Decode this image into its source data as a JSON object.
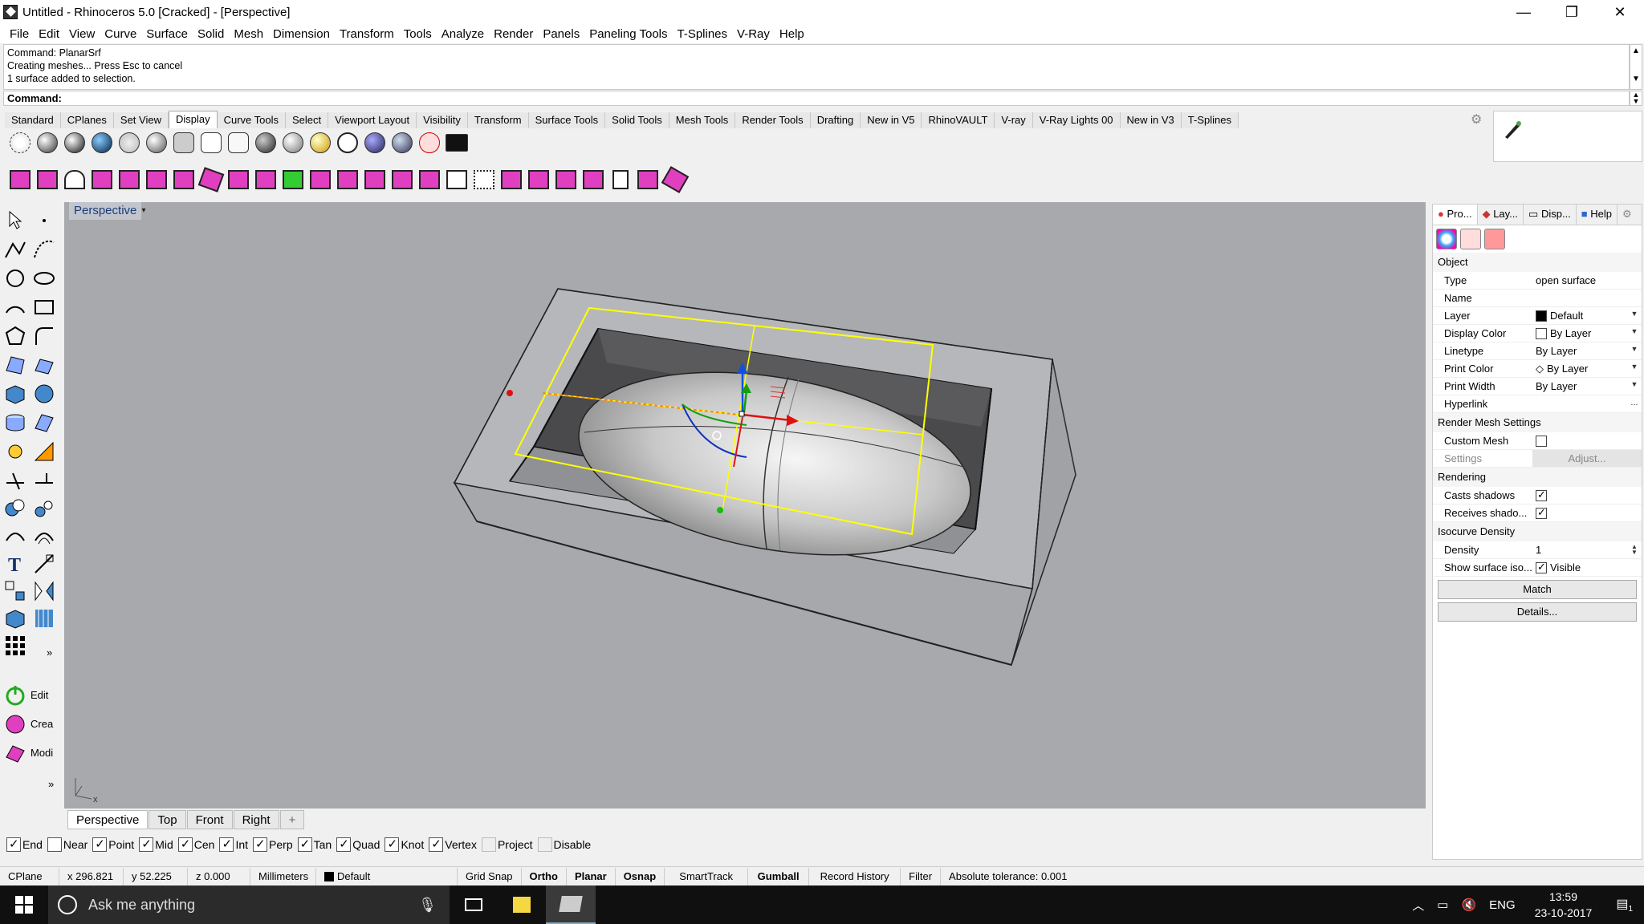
{
  "window": {
    "title": "Untitled - Rhinoceros 5.0 [Cracked] - [Perspective]",
    "minimize": "—",
    "maximize": "❐",
    "close": "✕"
  },
  "menu": [
    "File",
    "Edit",
    "View",
    "Curve",
    "Surface",
    "Solid",
    "Mesh",
    "Dimension",
    "Transform",
    "Tools",
    "Analyze",
    "Render",
    "Panels",
    "Paneling Tools",
    "T-Splines",
    "V-Ray",
    "Help"
  ],
  "command_history": [
    "Command: PlanarSrf",
    "Creating meshes... Press Esc to cancel",
    "1 surface added to selection."
  ],
  "command_prompt": {
    "label": "Command:",
    "value": ""
  },
  "toolbar_tabs": [
    "Standard",
    "CPlanes",
    "Set View",
    "Display",
    "Curve Tools",
    "Select",
    "Viewport Layout",
    "Visibility",
    "Transform",
    "Surface Tools",
    "Solid Tools",
    "Mesh Tools",
    "Render Tools",
    "Drafting",
    "New in V5",
    "RhinoVAULT",
    "V-ray",
    "V-Ray Lights 00",
    "New in V3",
    "T-Splines"
  ],
  "toolbar_active_tab": "Display",
  "left_tools": {
    "edit": "Edit",
    "create": "Crea",
    "modify": "Modi",
    "more": "»"
  },
  "viewport": {
    "title": "Perspective",
    "caret": "▾",
    "axis_x": "x"
  },
  "viewport_tabs": [
    "Perspective",
    "Top",
    "Front",
    "Right"
  ],
  "viewport_tab_add": "+",
  "osnaps": [
    {
      "label": "End",
      "on": true
    },
    {
      "label": "Near",
      "on": false
    },
    {
      "label": "Point",
      "on": true
    },
    {
      "label": "Mid",
      "on": true
    },
    {
      "label": "Cen",
      "on": true
    },
    {
      "label": "Int",
      "on": true
    },
    {
      "label": "Perp",
      "on": true
    },
    {
      "label": "Tan",
      "on": true
    },
    {
      "label": "Quad",
      "on": true
    },
    {
      "label": "Knot",
      "on": true
    },
    {
      "label": "Vertex",
      "on": true
    },
    {
      "label": "Project",
      "on": false,
      "disabled": true
    },
    {
      "label": "Disable",
      "on": false,
      "disabled": true
    }
  ],
  "status": {
    "cplane": "CPlane",
    "x": "x 296.821",
    "y": "y 52.225",
    "z": "z 0.000",
    "units": "Millimeters",
    "layer": "Default",
    "grid_snap": "Grid Snap",
    "ortho": "Ortho",
    "planar": "Planar",
    "osnap": "Osnap",
    "smarttrack": "SmartTrack",
    "gumball": "Gumball",
    "record_history": "Record History",
    "filter": "Filter",
    "tolerance": "Absolute tolerance: 0.001"
  },
  "props": {
    "tabs": [
      "Pro...",
      "Lay...",
      "Disp...",
      "Help"
    ],
    "section_object": "Object",
    "type_k": "Type",
    "type_v": "open surface",
    "name_k": "Name",
    "name_v": "",
    "layer_k": "Layer",
    "layer_v": "Default",
    "dispcolor_k": "Display Color",
    "dispcolor_v": "By Layer",
    "linetype_k": "Linetype",
    "linetype_v": "By Layer",
    "printcolor_k": "Print Color",
    "printcolor_v": "By Layer",
    "printwidth_k": "Print Width",
    "printwidth_v": "By Layer",
    "hyperlink_k": "Hyperlink",
    "hyperlink_btn": "...",
    "section_rms": "Render Mesh Settings",
    "custommesh_k": "Custom Mesh",
    "settings_k": "Settings",
    "adjust_btn": "Adjust...",
    "section_rendering": "Rendering",
    "casts_k": "Casts shadows",
    "receives_k": "Receives shado...",
    "section_iso": "Isocurve Density",
    "density_k": "Density",
    "density_v": "1",
    "showiso_k": "Show surface iso...",
    "showiso_v": "Visible",
    "match_btn": "Match",
    "details_btn": "Details..."
  },
  "taskbar": {
    "search_placeholder": "Ask me anything",
    "lang": "ENG",
    "time": "13:59",
    "date": "23-10-2017",
    "notif_count": "1"
  },
  "colors": {
    "accent": "#1a3c7a",
    "viewport_bg": "#a7a9ad",
    "selection": "#ffff00",
    "magenta": "#e040c0"
  }
}
